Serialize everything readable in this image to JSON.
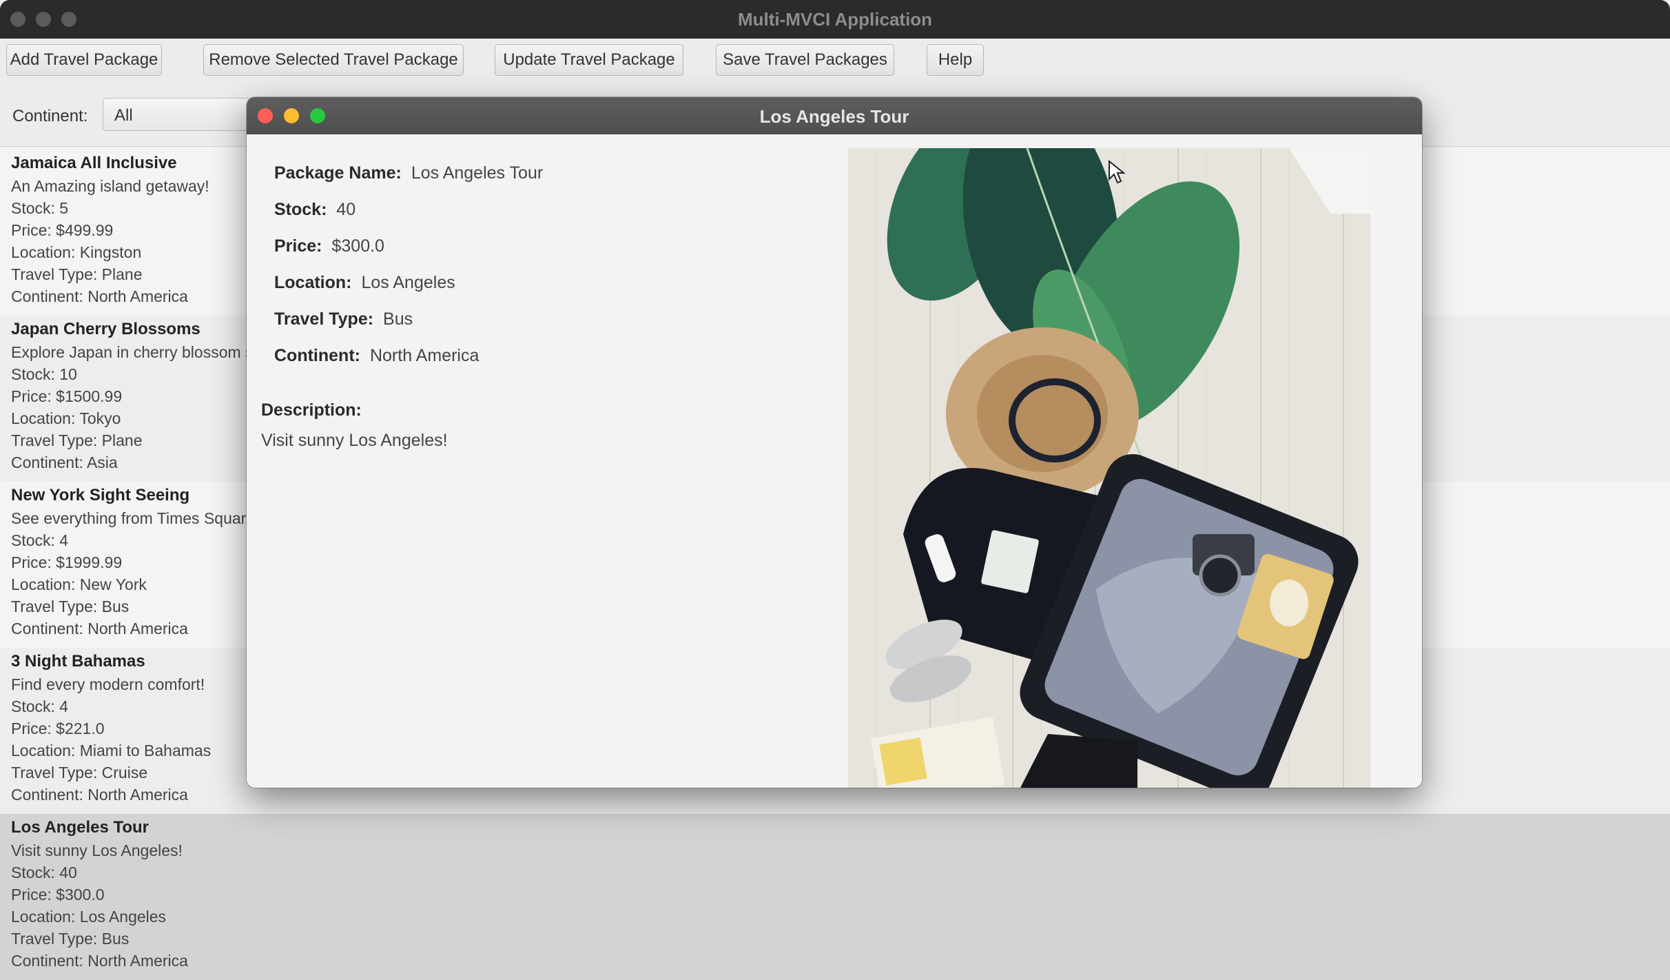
{
  "main_window": {
    "title": "Multi-MVCI Application"
  },
  "toolbar": {
    "add_label": "Add Travel Package",
    "remove_label": "Remove Selected Travel Package",
    "update_label": "Update Travel Package",
    "save_label": "Save Travel Packages",
    "help_label": "Help"
  },
  "filter": {
    "label": "Continent:",
    "selected": "All"
  },
  "packages": [
    {
      "name": "Jamaica All Inclusive",
      "description": "An Amazing island getaway!",
      "stock": "Stock: 5",
      "price": "Price: $499.99",
      "location": "Location: Kingston",
      "travel_type": "Travel Type: Plane",
      "continent": "Continent: North America"
    },
    {
      "name": "Japan Cherry Blossoms",
      "description": "Explore Japan in cherry blossom s",
      "stock": "Stock: 10",
      "price": "Price: $1500.99",
      "location": "Location: Tokyo",
      "travel_type": "Travel Type: Plane",
      "continent": "Continent: Asia"
    },
    {
      "name": "New York Sight Seeing",
      "description": "See everything from Times Squar",
      "stock": "Stock: 4",
      "price": "Price: $1999.99",
      "location": "Location: New York",
      "travel_type": "Travel Type: Bus",
      "continent": "Continent: North America"
    },
    {
      "name": "3 Night Bahamas",
      "description": "Find every modern comfort!",
      "stock": "Stock: 4",
      "price": "Price: $221.0",
      "location": "Location: Miami to Bahamas",
      "travel_type": "Travel Type: Cruise",
      "continent": "Continent: North America"
    },
    {
      "name": "Los Angeles Tour",
      "description": "Visit sunny Los Angeles!",
      "stock": "Stock: 40",
      "price": "Price: $300.0",
      "location": "Location: Los Angeles",
      "travel_type": "Travel Type: Bus",
      "continent": "Continent: North America"
    }
  ],
  "detail": {
    "window_title": "Los Angeles Tour",
    "package_name_label": "Package Name:",
    "package_name": "Los Angeles Tour",
    "stock_label": "Stock:",
    "stock": "40",
    "price_label": "Price:",
    "price": "$300.0",
    "location_label": "Location:",
    "location": "Los Angeles",
    "travel_type_label": "Travel Type:",
    "travel_type": "Bus",
    "continent_label": "Continent:",
    "continent": "North America",
    "description_label": "Description:",
    "description": "Visit sunny Los Angeles!"
  },
  "colors": {
    "close": "#ff5f57",
    "minimize": "#febc2e",
    "zoom": "#28c840"
  }
}
